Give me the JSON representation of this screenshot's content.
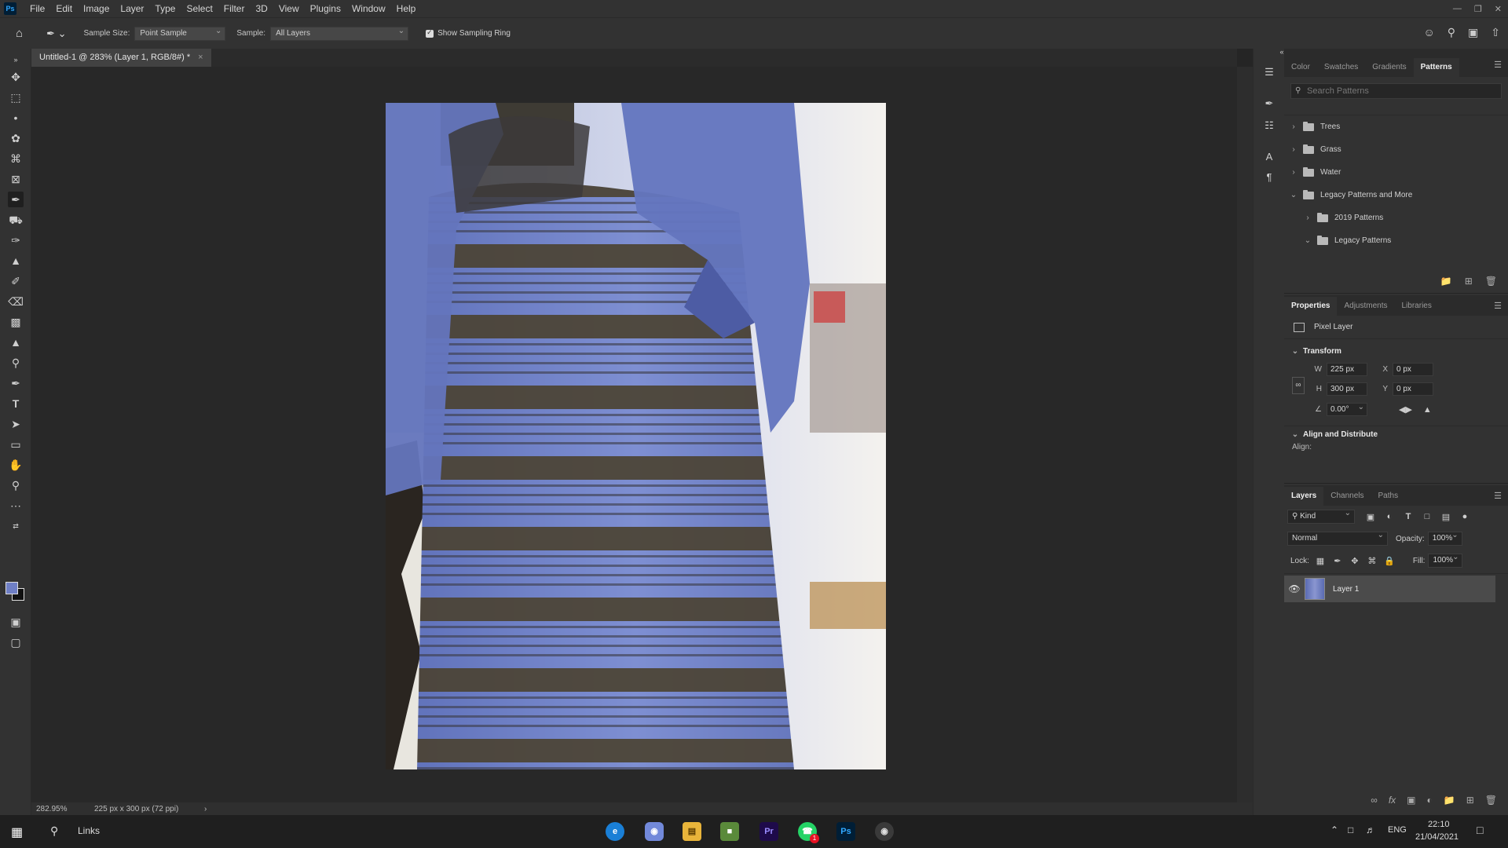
{
  "app": {
    "logo": "Ps"
  },
  "menu": [
    "File",
    "Edit",
    "Image",
    "Layer",
    "Type",
    "Select",
    "Filter",
    "3D",
    "View",
    "Plugins",
    "Window",
    "Help"
  ],
  "options": {
    "sample_size_label": "Sample Size:",
    "sample_size_value": "Point Sample",
    "sample_label": "Sample:",
    "sample_value": "All Layers",
    "show_ring_label": "Show Sampling Ring"
  },
  "document": {
    "tab_title": "Untitled-1 @ 283% (Layer 1, RGB/8#) *",
    "close": "×"
  },
  "status": {
    "zoom": "282.95%",
    "doc_size": "225 px x 300 px (72 ppi)",
    "arrow": "›"
  },
  "patterns_panel": {
    "tabs": [
      "Color",
      "Swatches",
      "Gradients",
      "Patterns"
    ],
    "active_tab": "Patterns",
    "search_placeholder": "Search Patterns",
    "items": [
      {
        "label": "Trees",
        "expanded": false,
        "indent": 0
      },
      {
        "label": "Grass",
        "expanded": false,
        "indent": 0
      },
      {
        "label": "Water",
        "expanded": false,
        "indent": 0
      },
      {
        "label": "Legacy Patterns and More",
        "expanded": true,
        "indent": 0
      },
      {
        "label": "2019 Patterns",
        "expanded": false,
        "indent": 1
      },
      {
        "label": "Legacy Patterns",
        "expanded": true,
        "indent": 1
      }
    ]
  },
  "properties_panel": {
    "tabs": [
      "Properties",
      "Adjustments",
      "Libraries"
    ],
    "active_tab": "Properties",
    "layer_type": "Pixel Layer",
    "transform_title": "Transform",
    "w_label": "W",
    "w_value": "225 px",
    "h_label": "H",
    "h_value": "300 px",
    "x_label": "X",
    "x_value": "0 px",
    "y_label": "Y",
    "y_value": "0 px",
    "angle_value": "0.00°",
    "align_title": "Align and Distribute",
    "align_label": "Align:"
  },
  "layers_panel": {
    "tabs": [
      "Layers",
      "Channels",
      "Paths"
    ],
    "active_tab": "Layers",
    "kind_label": "Kind",
    "blend_mode": "Normal",
    "opacity_label": "Opacity:",
    "opacity_value": "100%",
    "lock_label": "Lock:",
    "fill_label": "Fill:",
    "fill_value": "100%",
    "layers": [
      {
        "name": "Layer 1",
        "visible": true
      }
    ]
  },
  "taskbar": {
    "search_label": "Links",
    "lang": "ENG",
    "time": "22:10",
    "date": "21/04/2021",
    "notification_badge": "1"
  },
  "colors": {
    "foreground": "#6f7fc5",
    "background": "#111111",
    "accent": "#31a8ff"
  }
}
